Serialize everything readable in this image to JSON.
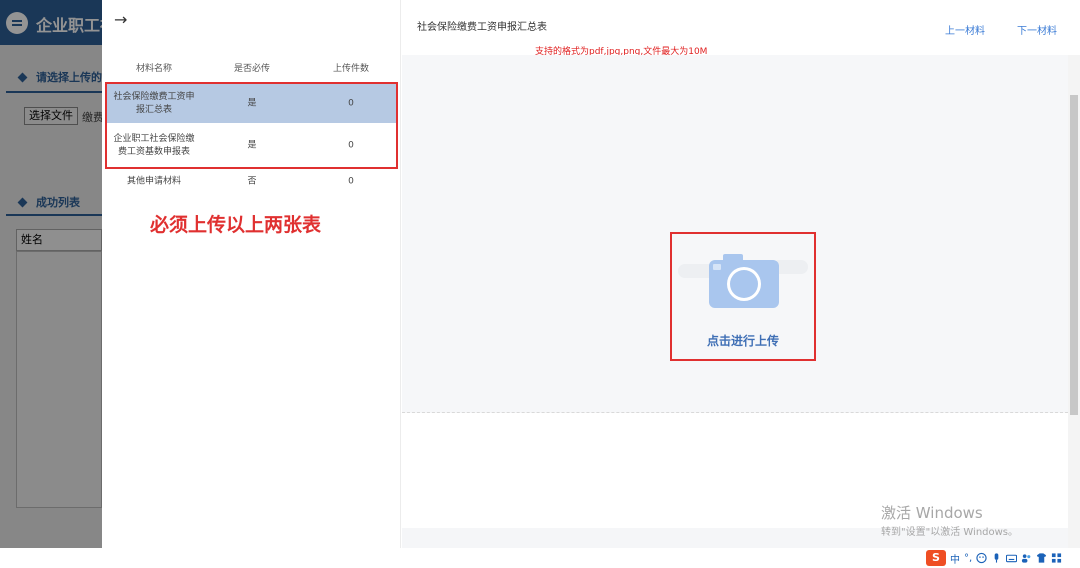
{
  "background": {
    "app_title": "企业职工社",
    "section1_label": "请选择上传的",
    "file_button": "选择文件",
    "file_text": "缴费",
    "section2_label": "成功列表",
    "table_header": "姓名"
  },
  "modal": {
    "back_icon": "→",
    "table": {
      "headers": [
        "材料名称",
        "是否必传",
        "上传件数"
      ],
      "rows": [
        {
          "name_line1": "社会保险缴费工资申",
          "name_line2": "报汇总表",
          "required": "是",
          "count": "0",
          "selected": true
        },
        {
          "name_line1": "企业职工社会保险缴",
          "name_line2": "费工资基数申报表",
          "required": "是",
          "count": "0",
          "selected": false
        },
        {
          "name_line1": "其他申请材料",
          "name_line2": "",
          "required": "否",
          "count": "0",
          "selected": false
        }
      ]
    },
    "annotation": "必须上传以上两张表",
    "doc_title": "社会保险缴费工资申报汇总表",
    "prev_link": "上一材料",
    "next_link": "下一材料",
    "format_hint": "支持的格式为pdf,jpg,png,文件最大为10M",
    "upload_label": "点击进行上传",
    "camera_icon": "camera-icon"
  },
  "watermark": {
    "line1": "激活 Windows",
    "line2": "转到\"设置\"以激活 Windows。"
  },
  "tray": {
    "ime_logo": "S",
    "ime_lang": "中",
    "ime_punct": "°,"
  },
  "colors": {
    "accent": "#3a7bd5",
    "selected_row": "#b6c9e3",
    "highlight_red": "#e03030",
    "header_blue": "#2e5f96"
  }
}
